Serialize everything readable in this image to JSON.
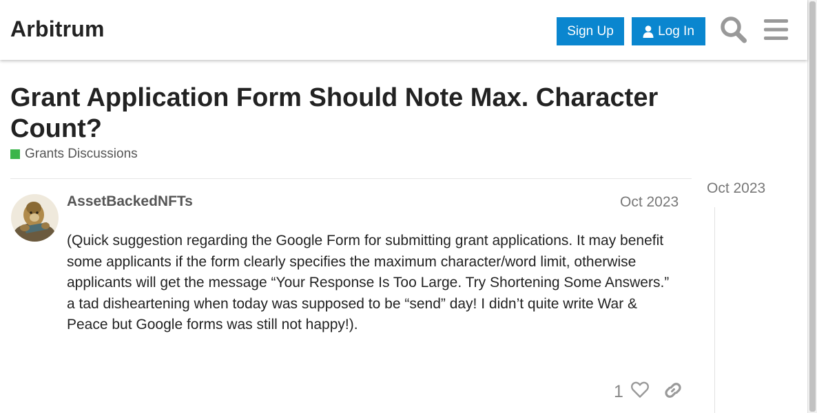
{
  "header": {
    "site_title": "Arbitrum",
    "signup_label": "Sign Up",
    "login_label": "Log In"
  },
  "topic": {
    "title": "Grant Application Form Should Note Max. Character Count?",
    "category": "Grants Discussions",
    "category_color": "#3ab54a"
  },
  "post": {
    "username": "AssetBackedNFTs",
    "date": "Oct 2023",
    "body": "(Quick suggestion regarding the Google Form for submitting grant applications. It may benefit some applicants if the form clearly specifies the maximum character/word limit, otherwise applicants will get the message “Your Response Is Too Large. Try Shortening Some Answers.” a tad disheartening when today was supposed to be “send” day! I didn’t quite write War & Peace but Google forms was still not happy!).",
    "like_count": "1"
  },
  "timeline": {
    "date": "Oct 2023"
  },
  "colors": {
    "accent": "#0a86cf",
    "icon_gray": "#999999"
  },
  "icons": [
    "user-icon",
    "search-icon",
    "hamburger-menu-icon",
    "heart-icon",
    "link-icon"
  ]
}
